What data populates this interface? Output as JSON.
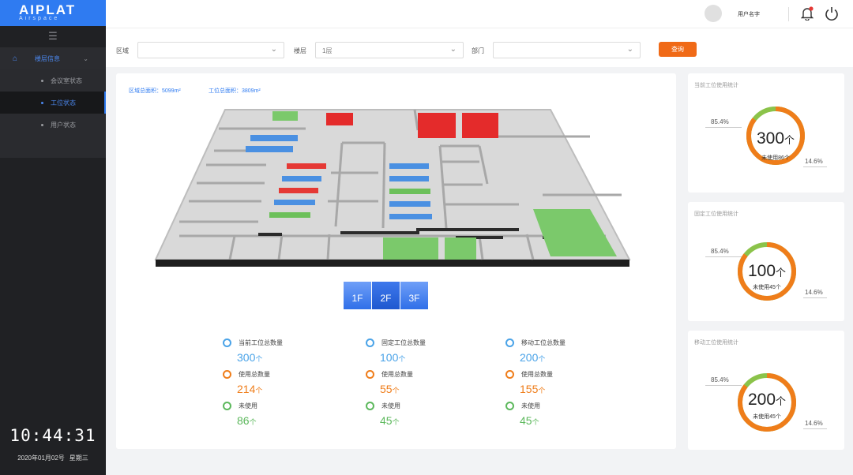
{
  "sidebar": {
    "logo": "AIPLAT",
    "logo_sub": "Airspace",
    "menu_group": "楼层信息",
    "items": [
      {
        "label": "会议室状态",
        "active": false
      },
      {
        "label": "工位状态",
        "active": true
      },
      {
        "label": "用户状态",
        "active": false
      }
    ],
    "clock": "10:44:31",
    "date": "2020年01月02号",
    "weekday": "星期三"
  },
  "topbar": {
    "username": "用户名字"
  },
  "filters": {
    "area_label": "区域",
    "area_value": "",
    "floor_label": "楼层",
    "floor_value": "1层",
    "dept_label": "部门",
    "dept_value": "",
    "query_label": "查询"
  },
  "main": {
    "area_total": "区域总面积：5099m²",
    "station_area": "工位总面积：3809m²",
    "floor_tabs": [
      "1F",
      "2F",
      "3F"
    ],
    "active_floor": "2F",
    "stats": [
      {
        "label": "当前工位总数量",
        "value": "300",
        "unit": "个",
        "color": "#4aa3e8"
      },
      {
        "label": "固定工位总数量",
        "value": "100",
        "unit": "个",
        "color": "#4aa3e8"
      },
      {
        "label": "移动工位总数量",
        "value": "200",
        "unit": "个",
        "color": "#4aa3e8"
      },
      {
        "label": "使用总数量",
        "value": "214",
        "unit": "个",
        "color": "#ef7d1a"
      },
      {
        "label": "使用总数量",
        "value": "55",
        "unit": "个",
        "color": "#ef7d1a"
      },
      {
        "label": "使用总数量",
        "value": "155",
        "unit": "个",
        "color": "#ef7d1a"
      },
      {
        "label": "未使用",
        "value": "86",
        "unit": "个",
        "color": "#5cb85c"
      },
      {
        "label": "未使用",
        "value": "45",
        "unit": "个",
        "color": "#5cb85c"
      },
      {
        "label": "未使用",
        "value": "45",
        "unit": "个",
        "color": "#5cb85c"
      }
    ]
  },
  "cards": [
    {
      "title": "当前工位使用统计",
      "used_pct": "85.4%",
      "unused_pct": "14.6%",
      "total": "300",
      "unit": "个",
      "unused_text": "未使用86个",
      "used_fraction": 0.854
    },
    {
      "title": "固定工位使用统计",
      "used_pct": "85.4%",
      "unused_pct": "14.6%",
      "total": "100",
      "unit": "个",
      "unused_text": "未使用45个",
      "used_fraction": 0.854
    },
    {
      "title": "移动工位使用统计",
      "used_pct": "85.4%",
      "unused_pct": "14.6%",
      "total": "200",
      "unit": "个",
      "unused_text": "未使用45个",
      "used_fraction": 0.854
    }
  ],
  "colors": {
    "accent": "#2f7bf1",
    "orange": "#ef7d1a",
    "green": "#8bc34a",
    "sidebar": "#202124"
  }
}
